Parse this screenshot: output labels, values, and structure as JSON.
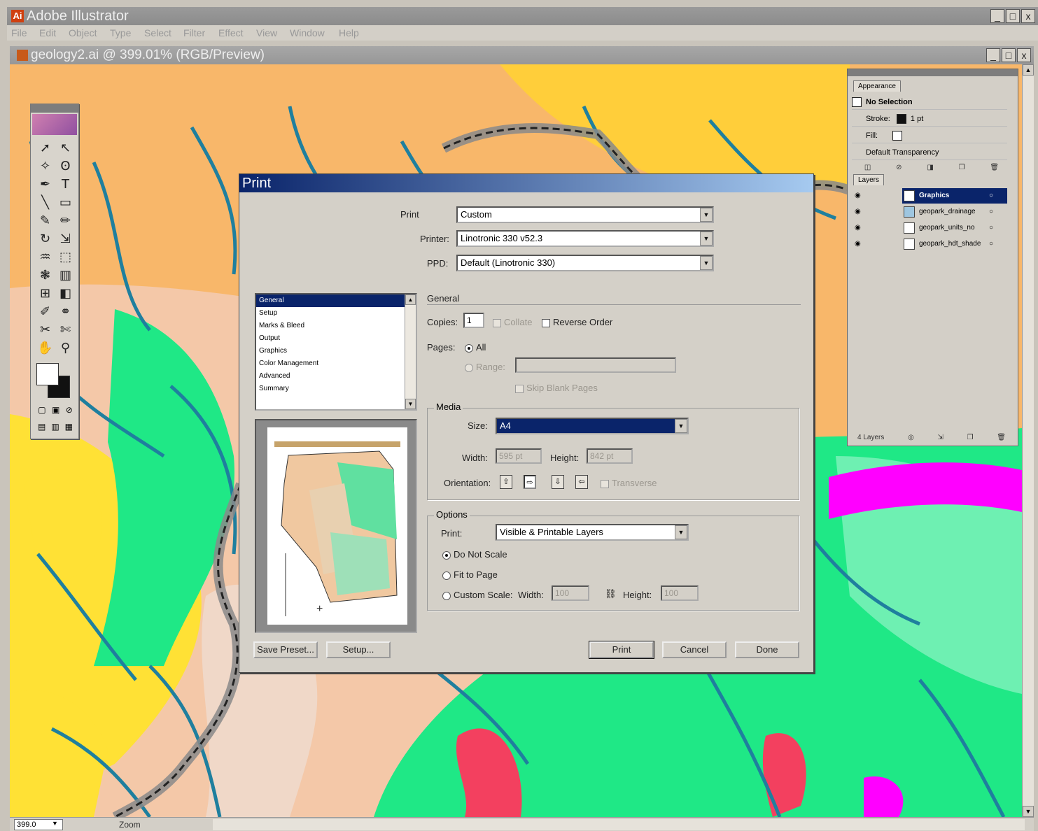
{
  "app": {
    "title": "Adobe Illustrator",
    "window_controls": [
      "_",
      "□",
      "x"
    ]
  },
  "menu": [
    "File",
    "Edit",
    "Object",
    "Type",
    "Select",
    "Filter",
    "Effect",
    "View",
    "Window",
    "Help"
  ],
  "document": {
    "title": "geology2.ai @ 399.01% (RGB/Preview)",
    "window_controls": [
      "_",
      "□",
      "x"
    ]
  },
  "status": {
    "zoom": "399.0",
    "field": "Zoom"
  },
  "appearance_panel": {
    "tab": "Appearance",
    "selection": "No Selection",
    "stroke_label": "Stroke:",
    "stroke_weight": "1 pt",
    "fill_label": "Fill:",
    "transparency": "Default Transparency"
  },
  "layers_panel": {
    "tab": "Layers",
    "layers": [
      {
        "name": "Graphics",
        "selected": true
      },
      {
        "name": "geopark_drainage",
        "selected": false
      },
      {
        "name": "geopark_units_no",
        "selected": false
      },
      {
        "name": "geopark_hdt_shade",
        "selected": false
      }
    ],
    "count": "4 Layers"
  },
  "print_dialog": {
    "title": "Print",
    "preset_label": "Print",
    "preset_value": "Custom",
    "printer_label": "Printer:",
    "printer_value": "Linotronic 330 v52.3",
    "ppd_label": "PPD:",
    "ppd_value": "Default (Linotronic 330)",
    "sections": [
      "General",
      "Setup",
      "Marks & Bleed",
      "Output",
      "Graphics",
      "Color Management",
      "Advanced",
      "Summary"
    ],
    "general_header": "General",
    "copies_label": "Copies:",
    "copies_value": "1",
    "collate_label": "Collate",
    "reverse_label": "Reverse Order",
    "pages_label": "Pages:",
    "pages_all": "All",
    "pages_range": "Range:",
    "skip_blank": "Skip Blank Pages",
    "media_title": "Media",
    "size_label": "Size:",
    "size_value": "A4",
    "width_label": "Width:",
    "width_value": "595 pt",
    "height_label": "Height:",
    "height_value": "842 pt",
    "orientation_label": "Orientation:",
    "transverse_label": "Transverse",
    "options_title": "Options",
    "print_layers_label": "Print:",
    "print_layers_value": "Visible & Printable Layers",
    "do_not_scale": "Do Not Scale",
    "fit_to_page": "Fit to Page",
    "custom_scale": "Custom Scale:",
    "scale_width_label": "Width:",
    "scale_width_value": "100",
    "scale_height_label": "Height:",
    "scale_height_value": "100",
    "buttons": {
      "save_preset": "Save Preset...",
      "setup": "Setup...",
      "print": "Print",
      "cancel": "Cancel",
      "done": "Done"
    }
  },
  "colors": {
    "dialog_title": "#0a246a",
    "map_green": "#1fe886",
    "map_orange": "#f8b76a",
    "map_yellow": "#ffe135",
    "map_pink": "#f06",
    "river": "#1f7f9e"
  }
}
